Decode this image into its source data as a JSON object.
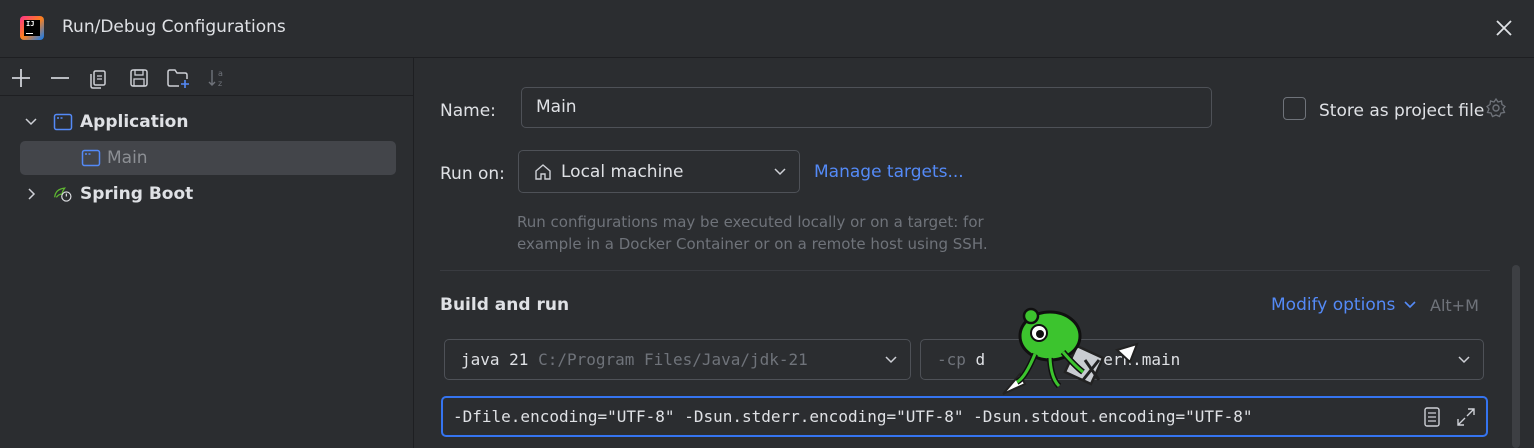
{
  "window": {
    "title": "Run/Debug Configurations",
    "logo_icon": "intellij-logo-icon",
    "close_icon": "close-icon"
  },
  "toolbar": {
    "icons": [
      "add-icon",
      "remove-icon",
      "copy-icon",
      "save-icon",
      "new-folder-icon",
      "sort-icon"
    ]
  },
  "tree": {
    "items": [
      {
        "label": "Application",
        "expanded": true,
        "icon": "application-icon",
        "bold": true
      },
      {
        "label": "Main",
        "selected": true,
        "icon": "application-icon",
        "bold": false
      },
      {
        "label": "Spring Boot",
        "expanded": false,
        "icon": "spring-boot-icon",
        "bold": true
      }
    ]
  },
  "form": {
    "name_label": "Name:",
    "name_value": "Main",
    "store_as_project_file": "Store as project file",
    "store_checked": false,
    "run_on_label": "Run on:",
    "run_on_value": "Local machine",
    "manage_targets": "Manage targets...",
    "hint_line1": "Run configurations may be executed locally or on a target: for",
    "hint_line2": "example in a Docker Container or on a remote host using SSH.",
    "build_and_run": "Build and run",
    "modify_options": "Modify options",
    "modify_shortcut": "Alt+M",
    "jdk_name": "java 21",
    "jdk_path": "C:/Program Files/Java/jdk-21",
    "cp_flag": "-cp",
    "cp_value_start": "d",
    "cp_value_end": "ern.main",
    "vm_options": "-Dfile.encoding=\"UTF-8\" -Dsun.stderr.encoding=\"UTF-8\" -Dsun.stdout.encoding=\"UTF-8\""
  },
  "colors": {
    "background": "#2b2d30",
    "accent": "#3574f0",
    "link": "#548af7",
    "text": "#dfe1e5",
    "muted": "#6f737a"
  }
}
